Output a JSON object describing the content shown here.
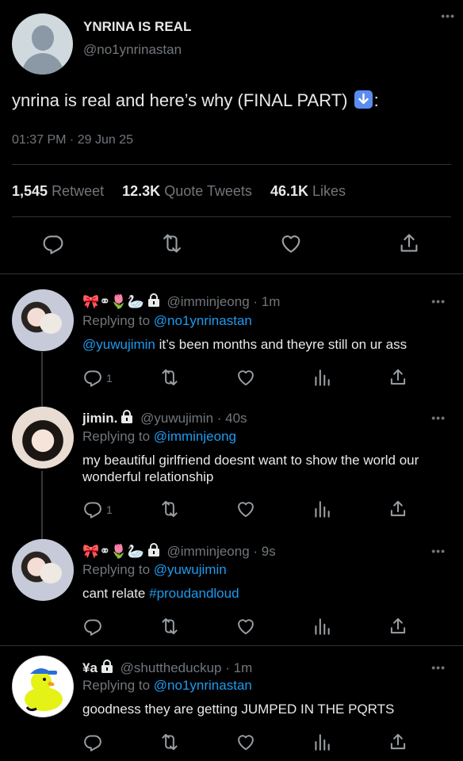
{
  "main_tweet": {
    "name": "YNRINA IS REAL",
    "handle": "@no1ynrinastan",
    "text": "ynrina is real and here’s why (FINAL PART)",
    "text_suffix": ":",
    "timestamp": "01:37 PM · 29 Jun 25",
    "stats": {
      "retweets": "1,545",
      "retweets_label": "Retweet",
      "quotes": "12.3K",
      "quotes_label": "Quote Tweets",
      "likes": "46.1K",
      "likes_label": "Likes"
    }
  },
  "replies": [
    {
      "name": "",
      "name_emojis": "🎀⚭🌷🦢",
      "handle": "@imminjeong",
      "time": "· 1m",
      "replying_label": "Replying to",
      "replying_to": "@no1ynrinastan",
      "mention": "@yuwujimin",
      "text": " it’s been months and theyre still on ur ass",
      "reply_count": "1"
    },
    {
      "name": "jimin.",
      "handle": "@yuwujimin",
      "time": "· 40s",
      "replying_label": "Replying to",
      "replying_to": "@imminjeong",
      "text": "my beautiful girlfriend doesnt want to show the world our wonderful relationship",
      "reply_count": "1"
    },
    {
      "name": "",
      "name_emojis": "🎀⚭🌷🦢",
      "handle": "@imminjeong",
      "time": "· 9s",
      "replying_label": "Replying to",
      "replying_to": "@yuwujimin",
      "text": "cant relate ",
      "hashtag": "#proudandloud"
    },
    {
      "name": "¥a",
      "handle": "@shuttheduckup",
      "time": "· 1m",
      "replying_label": "Replying to",
      "replying_to": "@no1ynrinastan",
      "text": "goodness they are getting JUMPED IN THE PQRTS"
    }
  ],
  "icons": {
    "reply": "reply-icon",
    "retweet": "retweet-icon",
    "like": "heart-icon",
    "views": "analytics-icon",
    "share": "share-icon",
    "more": "more-icon"
  },
  "colors": {
    "background": "#000000",
    "text": "#e7e9ea",
    "secondary": "#71767b",
    "accent": "#1d9bf0",
    "divider": "#2f3336"
  }
}
